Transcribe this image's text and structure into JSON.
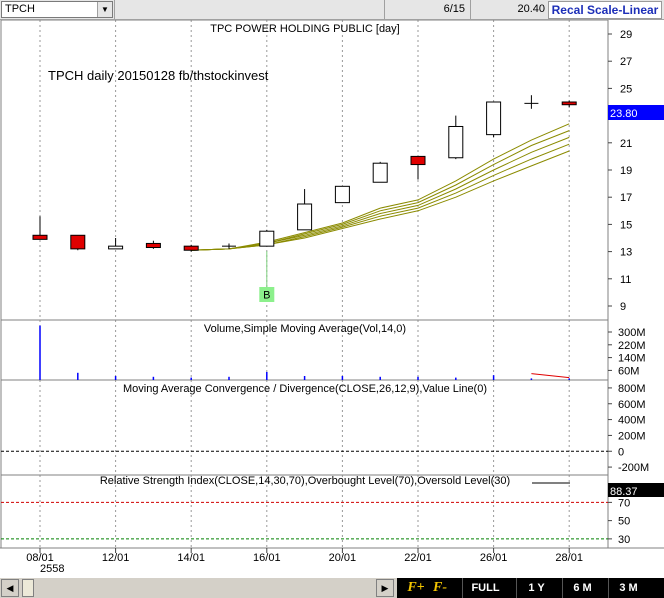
{
  "toolbar": {
    "symbol": "TPCH",
    "date": "6/15",
    "price": "20.40",
    "scale_mode": "Recal Scale-Linear"
  },
  "bottom_bar": {
    "zoom_in": "F+",
    "zoom_out": "F-",
    "ranges": [
      "FULL",
      "1 Y",
      "6 M",
      "3 M"
    ]
  },
  "colors": {
    "up": "#ffffff",
    "down": "#e00000",
    "ma": "#8b8b00",
    "price_marker": "#0000ff",
    "background": "#ffffff"
  },
  "chart_data": {
    "price": {
      "type": "candlestick",
      "title": "TPC POWER HOLDING PUBLIC [day]",
      "annotation": "TPCH daily 20150128 fb/thstockinvest",
      "signal": {
        "label": "B",
        "bar_index": 6
      },
      "last_value": "23.80",
      "ylim": [
        8.5,
        30
      ],
      "yticks": [
        9,
        11,
        13,
        15,
        17,
        19,
        21,
        23,
        25,
        27,
        29
      ],
      "candles": [
        {
          "o": 14.2,
          "h": 15.6,
          "l": 13.9,
          "c": 13.9
        },
        {
          "o": 14.2,
          "h": 14.2,
          "l": 13.1,
          "c": 13.2
        },
        {
          "o": 13.2,
          "h": 14.0,
          "l": 13.2,
          "c": 13.4
        },
        {
          "o": 13.6,
          "h": 13.8,
          "l": 13.2,
          "c": 13.3
        },
        {
          "o": 13.4,
          "h": 13.5,
          "l": 13.0,
          "c": 13.1
        },
        {
          "o": 13.4,
          "h": 13.6,
          "l": 13.2,
          "c": 13.4
        },
        {
          "o": 13.4,
          "h": 14.6,
          "l": 13.4,
          "c": 14.5
        },
        {
          "o": 14.6,
          "h": 17.6,
          "l": 14.6,
          "c": 16.5
        },
        {
          "o": 16.6,
          "h": 17.8,
          "l": 16.6,
          "c": 17.8
        },
        {
          "o": 18.1,
          "h": 19.6,
          "l": 18.1,
          "c": 19.5
        },
        {
          "o": 20.0,
          "h": 20.0,
          "l": 18.3,
          "c": 19.4
        },
        {
          "o": 19.9,
          "h": 23.0,
          "l": 19.8,
          "c": 22.2
        },
        {
          "o": 21.6,
          "h": 24.0,
          "l": 21.4,
          "c": 24.0
        },
        {
          "o": 23.9,
          "h": 24.5,
          "l": 23.5,
          "c": 23.9
        },
        {
          "o": 24.0,
          "h": 24.1,
          "l": 23.6,
          "c": 23.8
        }
      ],
      "ma_series": [
        {
          "start_index": 4,
          "values": [
            13.1,
            13.2,
            13.7,
            14.4,
            15.1,
            16.2,
            16.8,
            18.2,
            19.8,
            21.2,
            22.4
          ]
        },
        {
          "start_index": 4,
          "values": [
            13.1,
            13.2,
            13.6,
            14.3,
            15.0,
            16.0,
            16.6,
            17.9,
            19.4,
            20.8,
            21.9
          ]
        },
        {
          "start_index": 4,
          "values": [
            13.1,
            13.2,
            13.6,
            14.2,
            14.9,
            15.8,
            16.4,
            17.6,
            19.0,
            20.3,
            21.4
          ]
        },
        {
          "start_index": 4,
          "values": [
            13.1,
            13.2,
            13.5,
            14.1,
            14.8,
            15.6,
            16.2,
            17.3,
            18.6,
            19.8,
            20.9
          ]
        },
        {
          "start_index": 4,
          "values": [
            13.1,
            13.2,
            13.5,
            14.0,
            14.7,
            15.4,
            16.0,
            17.0,
            18.2,
            19.3,
            20.4
          ]
        }
      ]
    },
    "volume": {
      "type": "bar",
      "title": "Volume,Simple Moving Average(Vol,14,0)",
      "yticks": [
        "300M",
        "220M",
        "140M",
        "60M"
      ],
      "ylim": [
        0,
        350
      ],
      "values": [
        340,
        45,
        25,
        20,
        15,
        20,
        50,
        25,
        25,
        20,
        20,
        15,
        30,
        10,
        10
      ],
      "sma_segment": {
        "from_index": 13,
        "to_index": 14,
        "values": [
          40,
          15
        ]
      }
    },
    "macd": {
      "type": "line",
      "title": "Moving Average Convergence / Divergence(CLOSE,26,12,9),Value Line(0)",
      "yticks": [
        "800M",
        "600M",
        "400M",
        "200M",
        "0",
        "-200M"
      ]
    },
    "rsi": {
      "type": "line",
      "title": "Relative Strength Index(CLOSE,14,30,70),Overbought Level(70),Oversold Level(30)",
      "last_value": "88.37",
      "overbought": 70,
      "oversold": 30,
      "yticks": [
        "70",
        "50",
        "30"
      ]
    },
    "x_axis": {
      "tick_labels": [
        "08/01",
        "12/01",
        "14/01",
        "16/01",
        "20/01",
        "22/01",
        "26/01",
        "28/01"
      ],
      "tick_indices": [
        0,
        2,
        4,
        6,
        8,
        10,
        12,
        14
      ],
      "year": "2558"
    }
  }
}
